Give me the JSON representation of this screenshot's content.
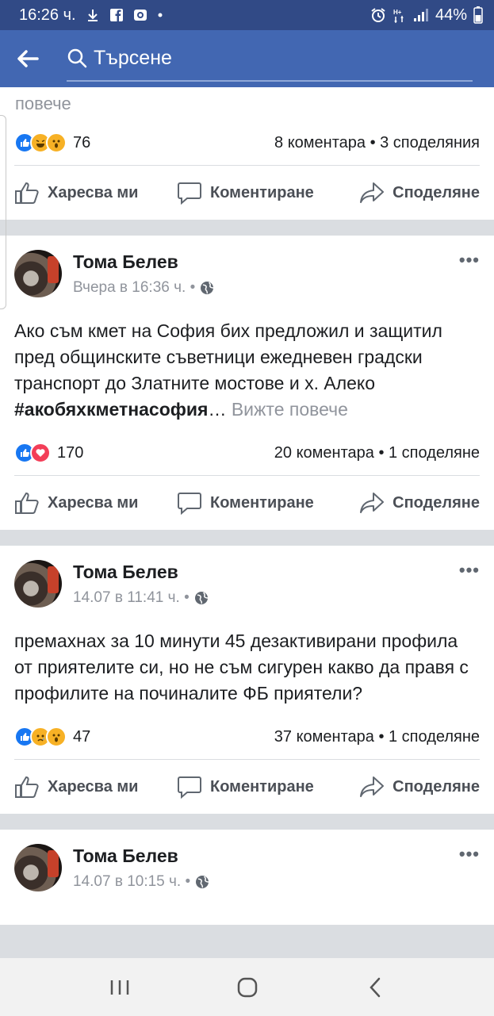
{
  "status_bar": {
    "time": "16:26 ч.",
    "battery": "44%",
    "icons_left": [
      "download-icon",
      "facebook-icon",
      "camera-icon",
      "dot-icon"
    ],
    "icons_right": [
      "alarm-icon",
      "network-icon",
      "signal-icon",
      "battery-icon"
    ]
  },
  "header": {
    "search_placeholder": "Търсене"
  },
  "top_post": {
    "see_more": "повече",
    "reaction_count": "76",
    "comments_shares": "8 коментара • 3 споделяния"
  },
  "actions": {
    "like": "Харесва ми",
    "comment": "Коментиране",
    "share": "Споделяне"
  },
  "posts": [
    {
      "author": "Тома Белев",
      "time": "Вчера в 16:36 ч. •",
      "text": "Ако съм кмет на София бих предложил и защитил пред общинските съветници ежедневен градски транспорт до Златните мостове и х. Алеко",
      "hashtag": "#акобяхкметнасофия",
      "ellipsis": "…",
      "see_more": "Вижте повече",
      "reaction_count": "170",
      "comments_shares": "20 коментара • 1 споделяне"
    },
    {
      "author": "Тома Белев",
      "time": "14.07 в 11:41 ч. •",
      "text": "премахнах за 10 минути 45 дезактивирани профила от приятелите си, но не съм сигурен какво да правя с профилите на починалите ФБ приятели?",
      "reaction_count": "47",
      "comments_shares": "37 коментара • 1 споделяне"
    },
    {
      "author": "Тома Белев",
      "time": "14.07 в 10:15 ч. •"
    }
  ],
  "colors": {
    "status_bar": "#314a86",
    "header": "#4267b2",
    "like_blue": "#1877f2",
    "love_red": "#f33e58",
    "haha_yellow": "#f7b125"
  }
}
